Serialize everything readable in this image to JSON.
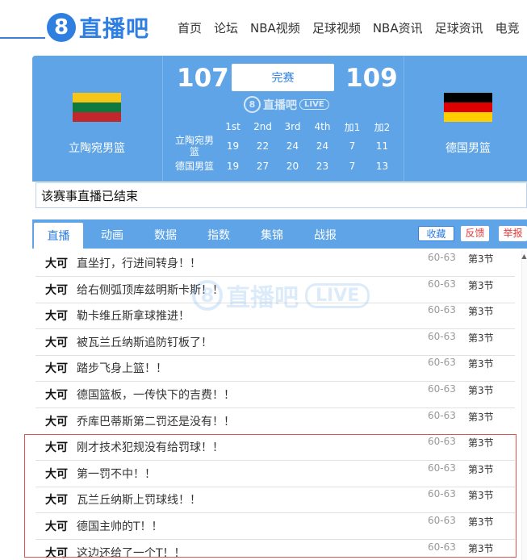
{
  "header": {
    "logo_mark": "8",
    "logo_text": "直播吧",
    "nav": [
      "首页",
      "论坛",
      "NBA视频",
      "足球视频",
      "NBA资讯",
      "足球资讯",
      "电竞"
    ]
  },
  "match": {
    "home": {
      "name": "立陶宛男篮",
      "score": "107",
      "flag_colors": [
        "#f5c518",
        "#0f7a3f",
        "#c1272d"
      ]
    },
    "away": {
      "name": "德国男篮",
      "score": "109",
      "flag_colors": [
        "#000000",
        "#dd0000",
        "#ffce00"
      ]
    },
    "status": "完赛",
    "mini_logo": {
      "mark": "8",
      "text": "直播吧",
      "badge": "LIVE"
    },
    "quarters": {
      "headers": [
        "1st",
        "2nd",
        "3rd",
        "4th",
        "加1",
        "加2"
      ],
      "home_label": "立陶宛男篮",
      "home": [
        "19",
        "22",
        "24",
        "24",
        "7",
        "11"
      ],
      "away_label": "德国男篮",
      "away": [
        "19",
        "27",
        "20",
        "23",
        "7",
        "13"
      ]
    }
  },
  "end_notice": "该赛事直播已结束",
  "tabs": [
    "直播",
    "动画",
    "数据",
    "指数",
    "集锦",
    "战报"
  ],
  "actions": {
    "favorite": "收藏",
    "feedback": "反馈",
    "report": "举报"
  },
  "watermark": {
    "mark": "8",
    "text": "直播吧",
    "badge": "LIVE"
  },
  "feed": [
    {
      "author": "大可",
      "text": "直坐打，行进间转身！！",
      "score": "60-63",
      "period": "第3节"
    },
    {
      "author": "大可",
      "text": "给右侧弧顶库兹明斯卡斯！！",
      "score": "60-63",
      "period": "第3节"
    },
    {
      "author": "大可",
      "text": "勒卡维丘斯拿球推进！",
      "score": "60-63",
      "period": "第3节"
    },
    {
      "author": "大可",
      "text": "被瓦兰丘纳斯追防钉板了！",
      "score": "60-63",
      "period": "第3节"
    },
    {
      "author": "大可",
      "text": "踏步飞身上篮！！",
      "score": "60-63",
      "period": "第3节"
    },
    {
      "author": "大可",
      "text": "德国篮板，一传快下的吉费！！",
      "score": "60-63",
      "period": "第3节"
    },
    {
      "author": "大可",
      "text": "乔库巴蒂斯第二罚还是没有！！",
      "score": "60-63",
      "period": "第3节"
    },
    {
      "author": "大可",
      "text": "刚才技术犯规没有给罚球！！",
      "score": "60-63",
      "period": "第3节"
    },
    {
      "author": "大可",
      "text": "第一罚不中！！",
      "score": "60-63",
      "period": "第3节"
    },
    {
      "author": "大可",
      "text": "瓦兰丘纳斯上罚球线！！",
      "score": "60-63",
      "period": "第3节"
    },
    {
      "author": "大可",
      "text": "德国主帅的T！！",
      "score": "60-63",
      "period": "第3节"
    },
    {
      "author": "大可",
      "text": "这边还给了一个T！！",
      "score": "60-63",
      "period": "第3节"
    }
  ]
}
